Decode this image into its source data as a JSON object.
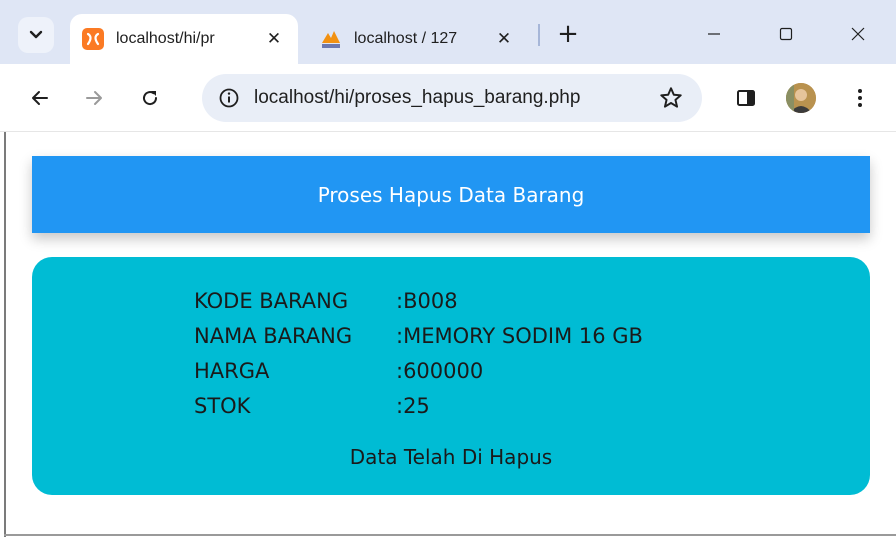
{
  "browser": {
    "tabs": [
      {
        "title": "localhost/hi/pr",
        "active": true,
        "favicon": "xampp-icon"
      },
      {
        "title": "localhost / 127",
        "active": false,
        "favicon": "phpmyadmin-icon"
      }
    ],
    "address": {
      "url": "localhost/hi/proses_hapus_barang.php"
    }
  },
  "page": {
    "header": {
      "title": "Proses Hapus Data Barang"
    },
    "fields": [
      {
        "label": "KODE BARANG",
        "value": ":B008"
      },
      {
        "label": "NAMA BARANG",
        "value": ":MEMORY SODIM 16 GB"
      },
      {
        "label": "HARGA",
        "value": ":600000"
      },
      {
        "label": "STOK",
        "value": ":25"
      }
    ],
    "status": "Data Telah Di Hapus"
  },
  "colors": {
    "header_bg": "#2196f3",
    "card_bg": "#00bcd4",
    "tabstrip_bg": "#dfe6f5",
    "omnibox_bg": "#e9eef7"
  }
}
